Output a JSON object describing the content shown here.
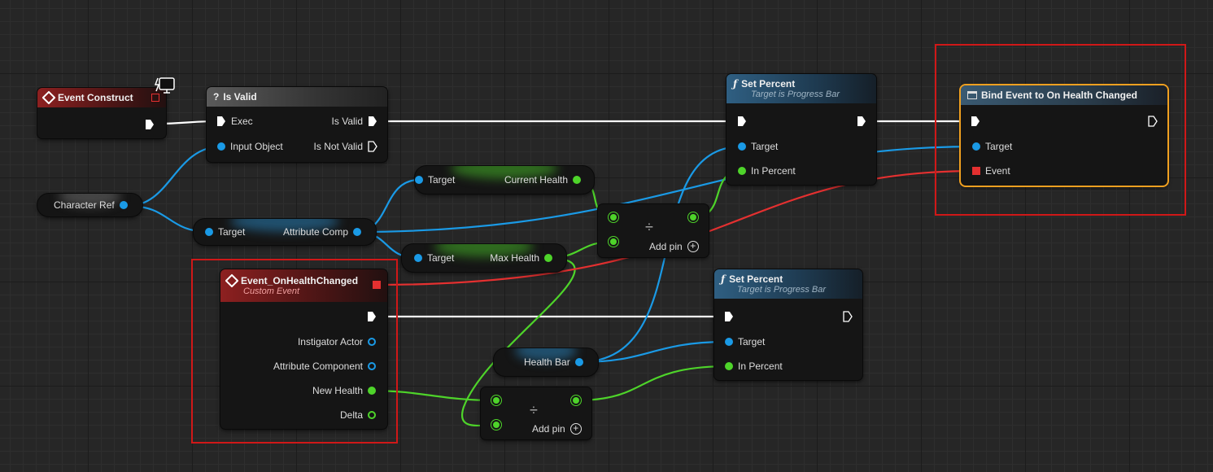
{
  "nodes": {
    "event_construct": {
      "title": "Event Construct"
    },
    "is_valid": {
      "title": "Is Valid",
      "exec_label": "Exec",
      "input_object_label": "Input Object",
      "is_valid_label": "Is Valid",
      "is_not_valid_label": "Is Not Valid"
    },
    "set_percent_top": {
      "title": "Set Percent",
      "subtitle": "Target is Progress Bar",
      "target_label": "Target",
      "in_percent_label": "In Percent"
    },
    "bind_event": {
      "title": "Bind Event to On Health Changed",
      "target_label": "Target",
      "event_label": "Event"
    },
    "character_ref": {
      "label": "Character Ref"
    },
    "attribute_comp_getter": {
      "target_label": "Target",
      "out_label": "Attribute Comp"
    },
    "current_health_getter": {
      "target_label": "Target",
      "out_label": "Current Health"
    },
    "max_health_getter": {
      "target_label": "Target",
      "out_label": "Max Health"
    },
    "divide_top": {
      "symbol": "÷",
      "add_pin_label": "Add pin"
    },
    "custom_event": {
      "title": "Event_OnHealthChanged",
      "subtitle": "Custom Event",
      "pins": [
        "Instigator Actor",
        "Attribute Component",
        "New Health",
        "Delta"
      ]
    },
    "set_percent_bottom": {
      "title": "Set Percent",
      "subtitle": "Target is Progress Bar",
      "target_label": "Target",
      "in_percent_label": "In Percent"
    },
    "health_bar": {
      "label": "Health Bar"
    },
    "divide_bottom": {
      "symbol": "÷",
      "add_pin_label": "Add pin"
    }
  },
  "colors": {
    "exec": "#ffffff",
    "object": "#1a9ae6",
    "float": "#4ed42a",
    "delegate": "#e43030",
    "highlight_frame": "#d01818",
    "selected_node": "#f0a020"
  }
}
